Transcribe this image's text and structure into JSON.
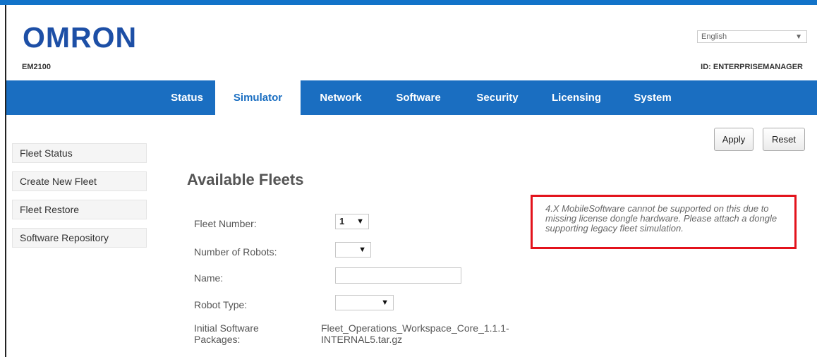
{
  "brand": {
    "logo_text": "OMRON",
    "model": "EM2100",
    "logo_color": "#1d4fa6"
  },
  "header": {
    "language": "English",
    "user_id": "ID: ENTERPRISEMANAGER"
  },
  "nav": {
    "items": [
      {
        "label": "Status"
      },
      {
        "label": "Simulator",
        "active": true
      },
      {
        "label": "Network"
      },
      {
        "label": "Software"
      },
      {
        "label": "Security"
      },
      {
        "label": "Licensing"
      },
      {
        "label": "System"
      }
    ],
    "bar_color": "#1a6ec1"
  },
  "sidebar": {
    "items": [
      {
        "label": "Fleet Status"
      },
      {
        "label": "Create New Fleet"
      },
      {
        "label": "Fleet Restore"
      },
      {
        "label": "Software Repository"
      }
    ]
  },
  "actions": {
    "apply_label": "Apply",
    "reset_label": "Reset"
  },
  "main": {
    "title": "Available Fleets",
    "fields": {
      "fleet_number": {
        "label": "Fleet Number:",
        "value": "1"
      },
      "number_of_robots": {
        "label": "Number of Robots:",
        "value": ""
      },
      "name": {
        "label": "Name:",
        "value": ""
      },
      "robot_type": {
        "label": "Robot Type:",
        "value": ""
      },
      "initial_packages": {
        "label_line1": "Initial Software",
        "label_line2": "Packages:",
        "value_line1": "Fleet_Operations_Workspace_Core_1.1.1-",
        "value_line2": "INTERNAL5.tar.gz"
      }
    }
  },
  "notice": {
    "text": "4.X MobileSoftware cannot be supported on this due to missing license dongle hardware. Please attach a dongle supporting legacy fleet simulation.",
    "border_color": "#e3131c"
  },
  "icons": {
    "dropdown_arrow": "▼"
  }
}
